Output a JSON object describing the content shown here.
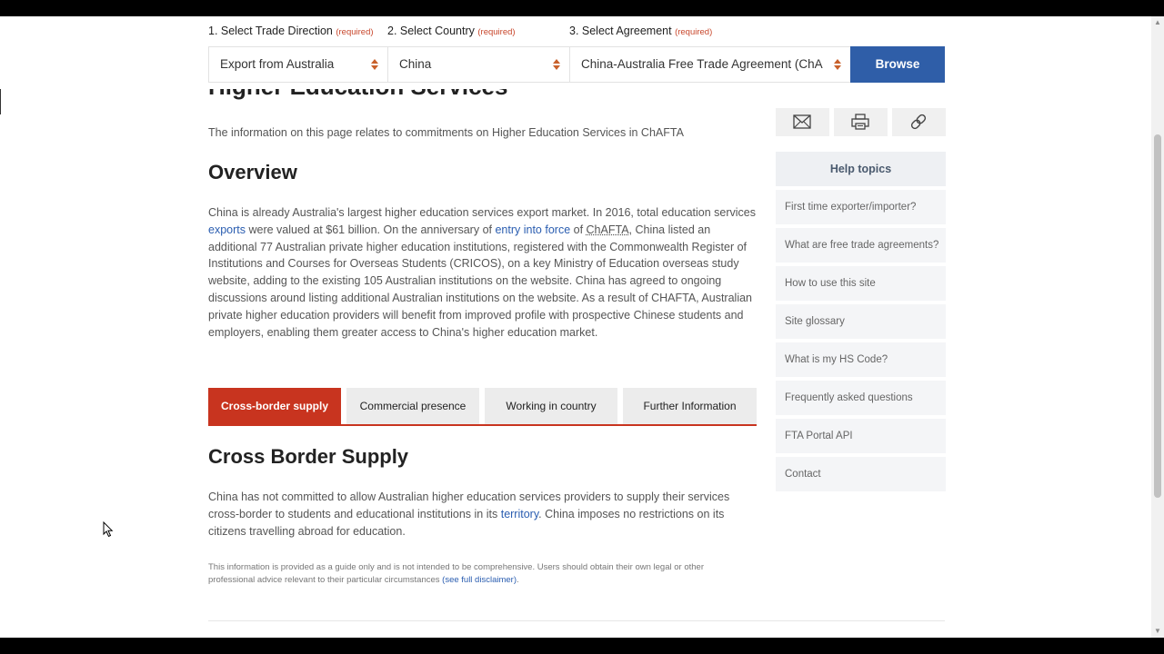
{
  "selectors": {
    "direction": {
      "label": "1. Select Trade Direction",
      "required": "(required)",
      "value": "Export from Australia"
    },
    "country": {
      "label": "2. Select Country",
      "required": "(required)",
      "value": "China"
    },
    "agreement": {
      "label": "3. Select Agreement",
      "required": "(required)",
      "value": "China-Australia Free Trade Agreement (ChA"
    },
    "browse_label": "Browse"
  },
  "page": {
    "title": "Higher Education Services",
    "intro": "The information on this page relates to commitments on Higher Education Services in ChAFTA",
    "overview_heading": "Overview",
    "overview": {
      "t1": "China is already Australia's largest higher education services export market. In 2016, total education services ",
      "l1": "exports",
      "t2": " were valued at $61 billion. On the anniversary of ",
      "l2": "entry into force",
      "t3": " of ",
      "abbr": "ChAFTA",
      "t4": ", China listed an additional 77 Australian private higher education institutions, registered with the Commonwealth Register of Institutions and Courses for Overseas Students (CRICOS), on a key Ministry of Education overseas study website, adding to the existing 105 Australian institutions on the website. China has agreed to ongoing discussions around listing additional Australian institutions on the website. As a result of CHAFTA, Australian private higher education providers will benefit from improved profile with prospective Chinese students and employers, enabling them greater access to China's higher education market."
    },
    "tabs": [
      "Cross-border supply",
      "Commercial presence",
      "Working in country",
      "Further Information"
    ],
    "cbs_heading": "Cross Border Supply",
    "cbs": {
      "t1": "China has not committed to allow Australian higher education services providers to supply their services cross-border to students and educational institutions in its ",
      "link": "territory",
      "t2": ". China imposes no restrictions on its citizens travelling abroad for education."
    },
    "disclaimer": {
      "text": "This information is provided as a guide only and is not intended to be comprehensive. Users should obtain their own legal or other professional advice relevant to their particular circumstances ",
      "link": "(see full disclaimer)",
      "end": "."
    }
  },
  "sidebar": {
    "share_icons": [
      "email-icon",
      "print-icon",
      "link-icon"
    ],
    "help_title": "Help topics",
    "help_items": [
      "First time exporter/importer?",
      "What are free trade agreements?",
      "How to use this site",
      "Site glossary",
      "What is my HS Code?",
      "Frequently asked questions",
      "FTA Portal API",
      "Contact"
    ]
  },
  "colors": {
    "accent_red": "#c8341f",
    "button_blue": "#2f5ea8",
    "link_blue": "#2a5db0",
    "caret_orange": "#c8602b"
  }
}
